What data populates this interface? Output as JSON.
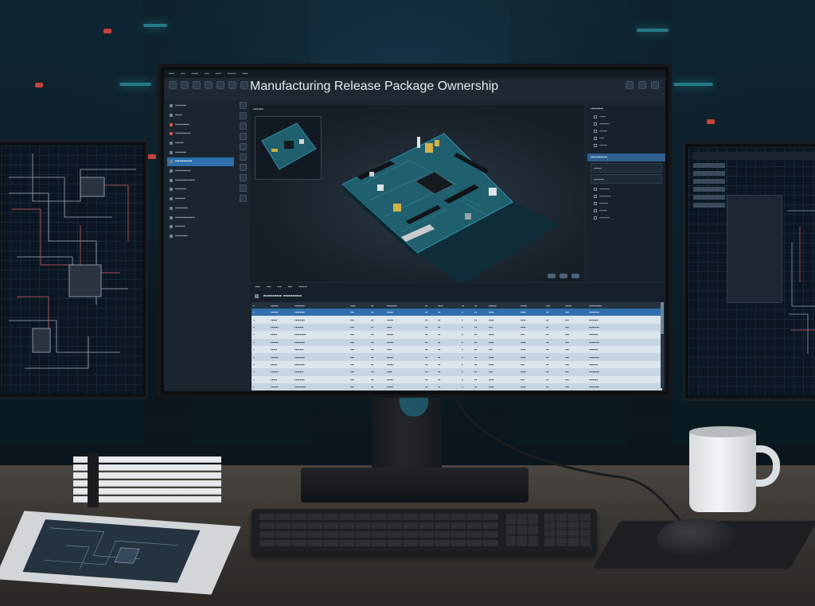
{
  "app": {
    "title": "Manufacturing Release Package Ownership"
  },
  "colors": {
    "accent": "#2f6fae",
    "selection": "#2f6fae",
    "pcb_green": "#1f5f6e",
    "background": "#08141c"
  },
  "icons": {
    "toolbar": [
      "new-icon",
      "open-icon",
      "save-icon",
      "undo-icon",
      "redo-icon",
      "settings-icon",
      "export-icon",
      "search-icon"
    ],
    "tool_column": [
      "select-icon",
      "move-icon",
      "rotate-icon",
      "zoom-icon",
      "measure-icon",
      "layer-icon",
      "view-icon",
      "grid-icon"
    ]
  },
  "left_nav": {
    "selected_index": 6
  },
  "viewport": {
    "subject": "3D view of a printed circuit board assembly"
  }
}
